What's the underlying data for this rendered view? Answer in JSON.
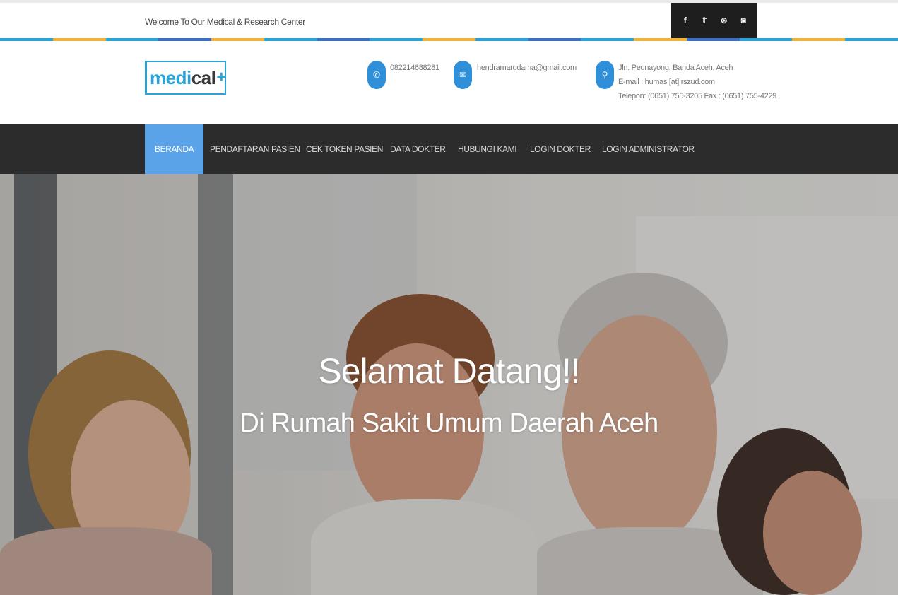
{
  "topbar": {
    "welcome": "Welcome To Our Medical & Research Center",
    "social": [
      {
        "icon": "facebook-icon",
        "glyph": "f"
      },
      {
        "icon": "twitter-icon",
        "glyph": "𝕥"
      },
      {
        "icon": "dribbble-icon",
        "glyph": "⊛"
      },
      {
        "icon": "instagram-icon",
        "glyph": "◙"
      }
    ]
  },
  "strip_colors": [
    "#2aa4d8",
    "#f0b23a",
    "#2aa4d8",
    "#3b6fc6",
    "#f0b23a",
    "#2aa4d8",
    "#3b6fc6",
    "#2aa4d8",
    "#f0b23a",
    "#2aa4d8",
    "#3b6fc6",
    "#2aa4d8",
    "#f0b23a",
    "#3b6fc6",
    "#2aa4d8",
    "#f0b23a",
    "#2aa4d8"
  ],
  "header": {
    "logo": {
      "part1": "medi",
      "part2": "cal",
      "plus": "+"
    },
    "phone": {
      "icon": "phone-icon",
      "text": "082214688281"
    },
    "email": {
      "icon": "mail-icon",
      "text": "hendramarudama@gmail.com"
    },
    "address": {
      "icon": "location-pin-icon",
      "line1": "Jln. Peunayong, Banda Aceh, Aceh",
      "line2": "E-mail : humas [at] rszud.com",
      "line3": "Telepon: (0651) 755-3205 Fax : (0651) 755-4229"
    }
  },
  "nav": {
    "items": [
      {
        "label": "BERANDA",
        "active": true
      },
      {
        "label": "PENDAFTARAN PASIEN"
      },
      {
        "label": "CEK TOKEN PASIEN"
      },
      {
        "label": "DATA DOKTER"
      },
      {
        "label": "HUBUNGI KAMI"
      },
      {
        "label": "LOGIN DOKTER"
      },
      {
        "label": "LOGIN ADMINISTRATOR"
      }
    ]
  },
  "hero": {
    "title": "Selamat Datang!!",
    "subtitle": "Di Rumah Sakit Umum Daerah Aceh"
  },
  "colors": {
    "accent": "#2aa4d8",
    "nav_bg": "#2c2c2c",
    "nav_active": "#5aa3e8",
    "icon_blue": "#2f8fd8"
  }
}
